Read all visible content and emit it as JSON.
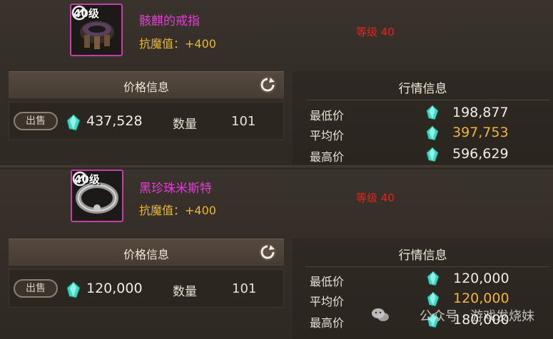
{
  "items": [
    {
      "level_badge": "40级",
      "name": "骸麒的戒指",
      "stat": "抗魔值：+400",
      "requirement": "等级 40",
      "price_header": "价格信息",
      "sell_label": "出售",
      "sell_price": "437,528",
      "qty_label": "数量",
      "qty_value": "101",
      "market": {
        "title": "行情信息",
        "min_label": "最低价",
        "min_value": "198,877",
        "avg_label": "平均价",
        "avg_value": "397,753",
        "max_label": "最高价",
        "max_value": "596,629"
      }
    },
    {
      "level_badge": "40级",
      "name": "黑珍珠米斯特",
      "stat": "抗魔值：+400",
      "requirement": "等级 40",
      "price_header": "价格信息",
      "sell_label": "出售",
      "sell_price": "120,000",
      "qty_label": "数量",
      "qty_value": "101",
      "market": {
        "title": "行情信息",
        "min_label": "最低价",
        "min_value": "120,000",
        "avg_label": "平均价",
        "avg_value": "120,000",
        "max_label": "最高价",
        "max_value": "180,000"
      }
    }
  ],
  "watermark": "公众号 · 游戏发烧妹",
  "colors": {
    "name": "#e53cd6",
    "stat": "#e8b833",
    "requirement": "#e3231d",
    "avg": "#f0b43a",
    "gem": "#3fd6c2"
  },
  "icons": [
    "refresh-icon",
    "gem-icon",
    "no-trade-icon",
    "ring-icon",
    "wechat-icon"
  ]
}
